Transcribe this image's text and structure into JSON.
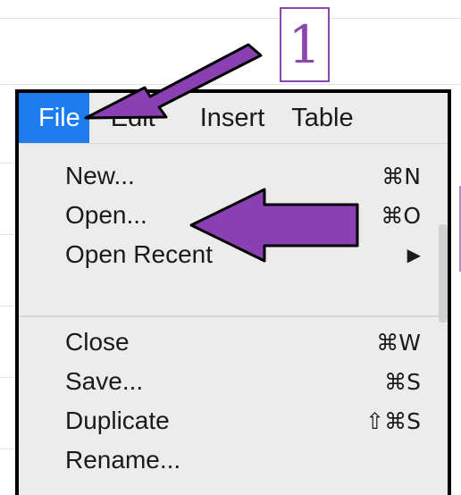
{
  "step": {
    "number": "1"
  },
  "menubar": {
    "items": [
      {
        "label": "File",
        "active": true
      },
      {
        "label": "Edit"
      },
      {
        "label": "Insert"
      },
      {
        "label": "Table"
      }
    ]
  },
  "file_menu": {
    "items": [
      {
        "label": "New...",
        "shortcut": "⌘N"
      },
      {
        "label": "Open...",
        "shortcut": "⌘O"
      },
      {
        "label": "Open Recent",
        "shortcut": "▶"
      },
      {
        "label": "Close",
        "shortcut": "⌘W"
      },
      {
        "label": "Save...",
        "shortcut": "⌘S"
      },
      {
        "label": "Duplicate",
        "shortcut": "⇧⌘S"
      },
      {
        "label": "Rename...",
        "shortcut": ""
      }
    ]
  },
  "annotations": {
    "arrow_color": "#8a3fb3",
    "highlight_color": "#1e7cf1"
  }
}
